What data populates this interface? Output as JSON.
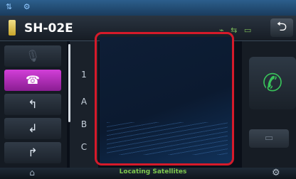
{
  "status": {
    "icons": "⇅ ⚙"
  },
  "header": {
    "device_name": "SH-02E",
    "signal": "⌁ ⇆ ▭",
    "back_icon": "⮌"
  },
  "sidebar": {
    "items": [
      {
        "icon": "🎙",
        "state": "dim"
      },
      {
        "icon": "☎",
        "state": "active"
      },
      {
        "icon": "↰",
        "state": "normal"
      },
      {
        "icon": "↲",
        "state": "normal"
      },
      {
        "icon": "↱",
        "state": "normal"
      }
    ]
  },
  "index_strip": {
    "letters": [
      "1",
      "A",
      "B",
      "C"
    ]
  },
  "right": {
    "call_icon": "✆",
    "message_icon": "▭"
  },
  "bottom": {
    "left_icon": "⌂",
    "status_text": "Locating Satellites",
    "settings_icon": "⚙"
  },
  "colors": {
    "accent_active": "#c63ecf",
    "highlight_frame": "#d61a2a",
    "call_green": "#39c25a",
    "gps_text": "#7fc94e"
  }
}
